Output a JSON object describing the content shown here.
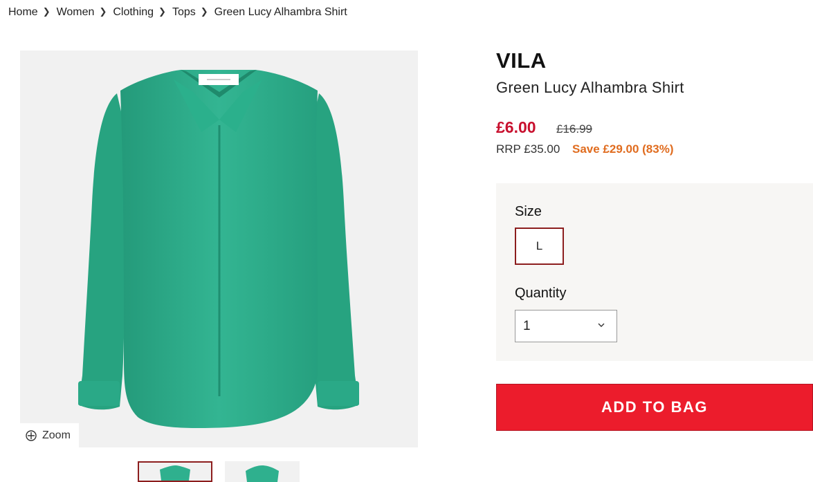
{
  "breadcrumb": {
    "items": [
      {
        "label": "Home"
      },
      {
        "label": "Women"
      },
      {
        "label": "Clothing"
      },
      {
        "label": "Tops"
      }
    ],
    "current": "Green Lucy Alhambra Shirt",
    "separator_icon": "chevron-right-icon"
  },
  "gallery": {
    "zoom_label": "Zoom",
    "zoom_icon": "zoom-crosshair-icon",
    "selected_thumbnail": 1,
    "thumbnail_count": 2
  },
  "product": {
    "brand": "VILA",
    "title": "Green Lucy Alhambra Shirt",
    "price_now": "£6.00",
    "price_was": "£16.99",
    "rrp": "RRP £35.00",
    "save": "Save £29.00 (83%)"
  },
  "options": {
    "size_label": "Size",
    "sizes": [
      "L"
    ],
    "selected_size": "L",
    "quantity_label": "Quantity",
    "quantity_value": "1",
    "quantity_icon": "chevron-down-icon"
  },
  "actions": {
    "add_to_bag": "ADD TO BAG"
  },
  "colors": {
    "price_red": "#c8102e",
    "save_orange": "#e06c1f",
    "button_red": "#ec1c2c",
    "selected_border": "#8c1d1d",
    "shirt_green": "#2fb08e"
  }
}
